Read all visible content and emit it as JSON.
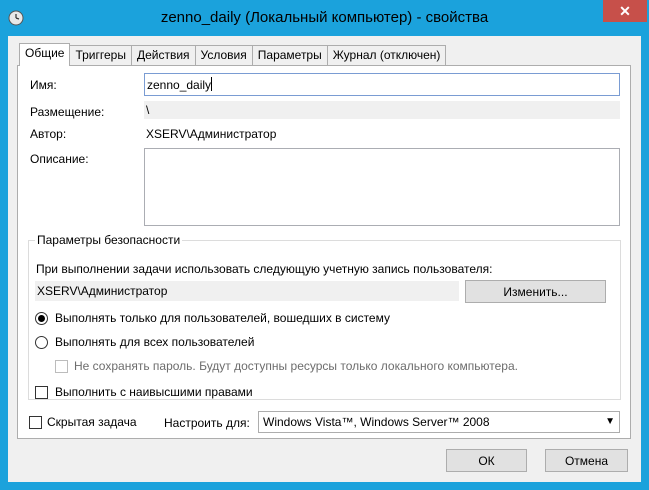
{
  "window": {
    "title": "zenno_daily (Локальный компьютер) - свойства",
    "close_glyph": "✕",
    "accent": "#1ba2dc"
  },
  "tabs": [
    {
      "label": "Общие",
      "active": true
    },
    {
      "label": "Триггеры"
    },
    {
      "label": "Действия"
    },
    {
      "label": "Условия"
    },
    {
      "label": "Параметры"
    },
    {
      "label": "Журнал (отключен)"
    }
  ],
  "general": {
    "name_label": "Имя:",
    "name_value": "zenno_daily",
    "location_label": "Размещение:",
    "location_value": "\\",
    "author_label": "Автор:",
    "author_value": "XSERV\\Администратор",
    "description_label": "Описание:",
    "description_value": ""
  },
  "security": {
    "group_title": "Параметры безопасности",
    "account_prompt": "При выполнении задачи использовать следующую учетную запись пользователя:",
    "account_value": "XSERV\\Администратор",
    "change_button": "Изменить...",
    "radio_logged_on": "Выполнять только для пользователей, вошедших в систему",
    "radio_all_users": "Выполнять для всех пользователей",
    "no_store_password": "Не сохранять пароль. Будут доступны ресурсы только локального компьютера.",
    "highest_privileges": "Выполнить с наивысшими правами"
  },
  "footer": {
    "hidden_task": "Скрытая задача",
    "configure_for_label": "Настроить для:",
    "configure_for_value": "Windows Vista™, Windows Server™ 2008",
    "ok_button": "ОК",
    "cancel_button": "Отмена"
  }
}
